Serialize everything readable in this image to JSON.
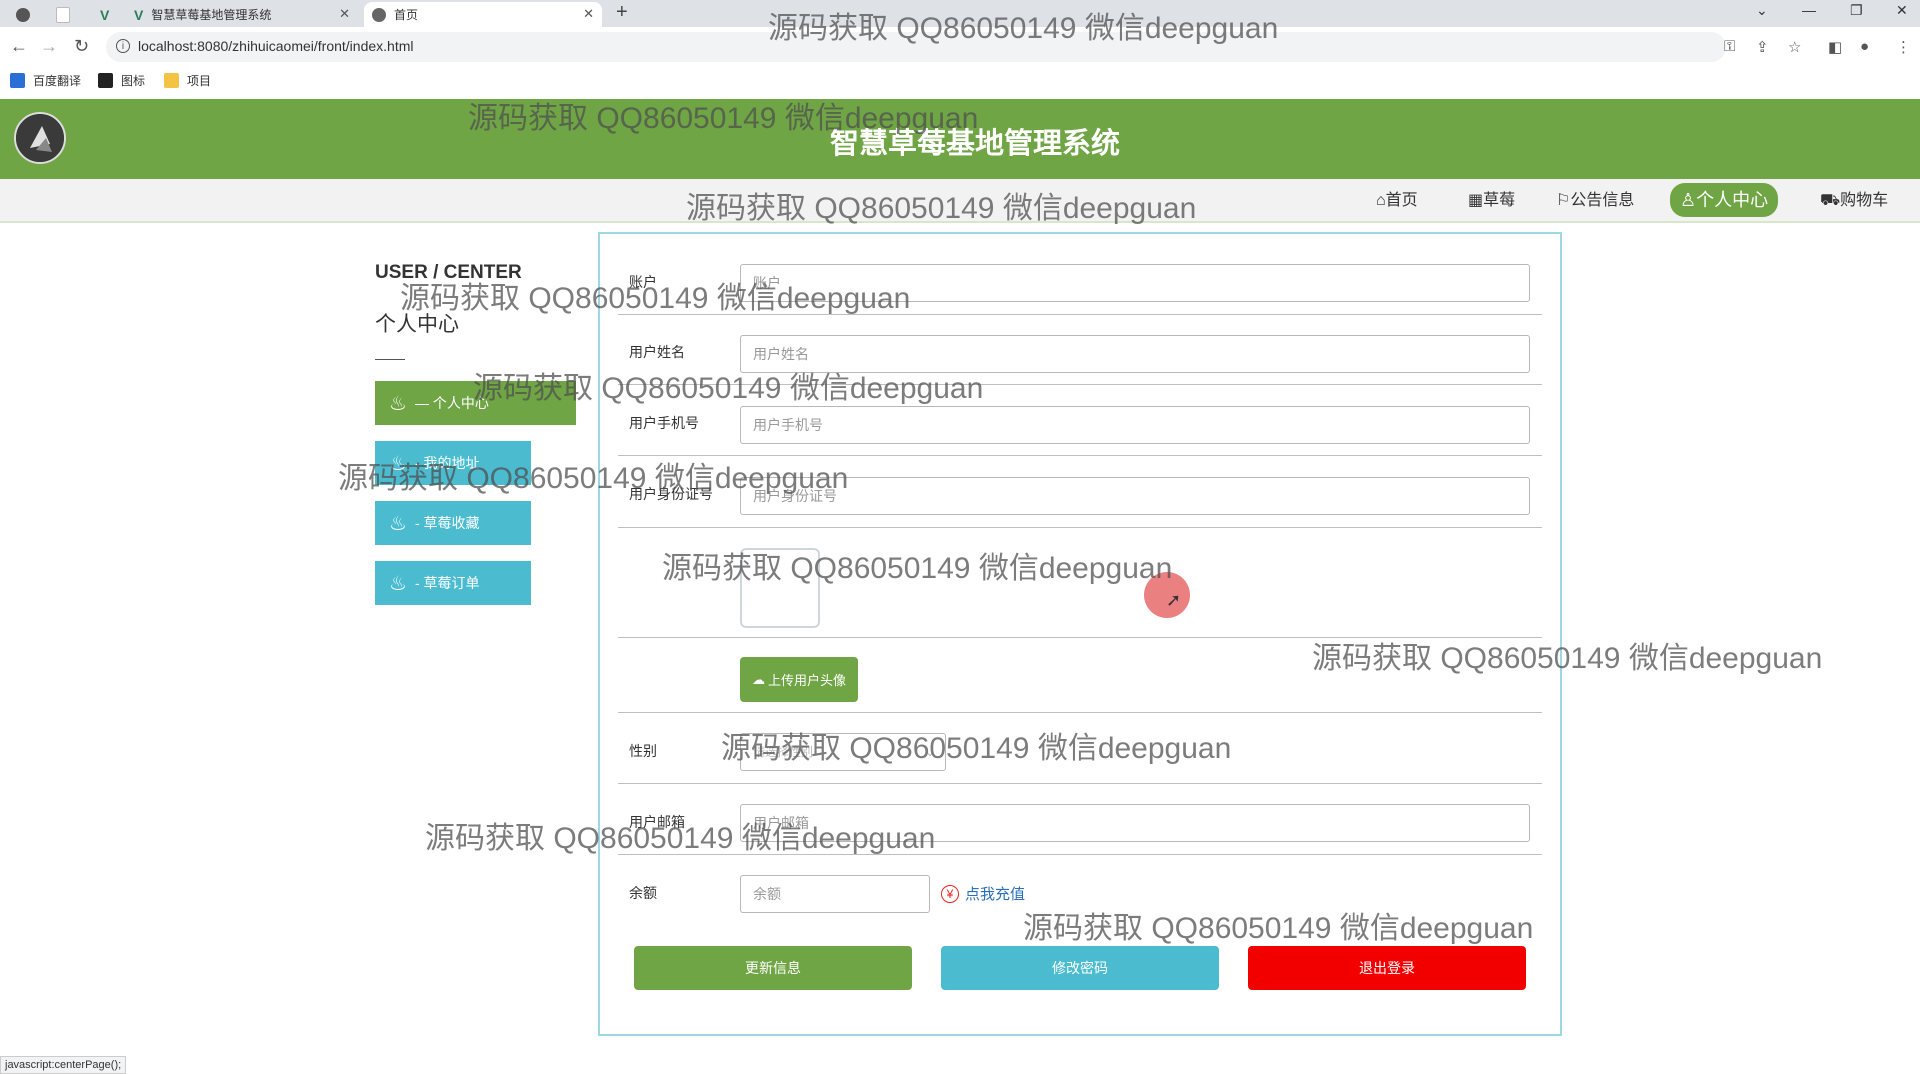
{
  "browser": {
    "tabs": [
      {
        "label": ""
      },
      {
        "label": ""
      },
      {
        "label": ""
      },
      {
        "label": "智慧草莓基地管理系统"
      },
      {
        "label": "首页"
      }
    ],
    "new_tab": "+",
    "url": "localhost:8080/zhihuicaomei/front/index.html",
    "bookmarks": [
      "百度翻译",
      "图标",
      "项目"
    ],
    "status_text": "javascript:centerPage();"
  },
  "site": {
    "title": "智慧草莓基地管理系统",
    "nav": [
      {
        "label": "首页",
        "icon": "home-icon",
        "active": false
      },
      {
        "label": "草莓",
        "icon": "grid-icon",
        "active": false
      },
      {
        "label": "公告信息",
        "icon": "flag-icon",
        "active": false
      },
      {
        "label": "个人中心",
        "icon": "user-icon",
        "active": true
      },
      {
        "label": "购物车",
        "icon": "cart-icon",
        "active": false
      }
    ]
  },
  "sidebar": {
    "title_en": "USER / CENTER",
    "title_cn": "个人中心",
    "items": [
      {
        "label": "— 个人中心",
        "active": true
      },
      {
        "label": "- 我的地址",
        "active": false
      },
      {
        "label": "- 草莓收藏",
        "active": false
      },
      {
        "label": "- 草莓订单",
        "active": false
      }
    ]
  },
  "form": {
    "fields": [
      {
        "label": "账户",
        "placeholder": "账户"
      },
      {
        "label": "用户姓名",
        "placeholder": "用户姓名"
      },
      {
        "label": "用户手机号",
        "placeholder": "用户手机号"
      },
      {
        "label": "用户身份证号",
        "placeholder": "用户身份证号"
      }
    ],
    "upload_button": "上传用户头像",
    "gender": {
      "label": "性别",
      "placeholder": "请选择性别"
    },
    "email": {
      "label": "用户邮箱",
      "placeholder": "用户邮箱"
    },
    "balance": {
      "label": "余额",
      "placeholder": "余额"
    },
    "recharge_link": "点我充值",
    "buttons": {
      "update": "更新信息",
      "change_password": "修改密码",
      "logout": "退出登录"
    }
  },
  "watermark": "源码获取 QQ86050149 微信deepguan",
  "colors": {
    "brand_green": "#6fa544",
    "teal": "#4bbcd0",
    "danger": "#f20000",
    "panel_border": "#9ed6e3"
  }
}
